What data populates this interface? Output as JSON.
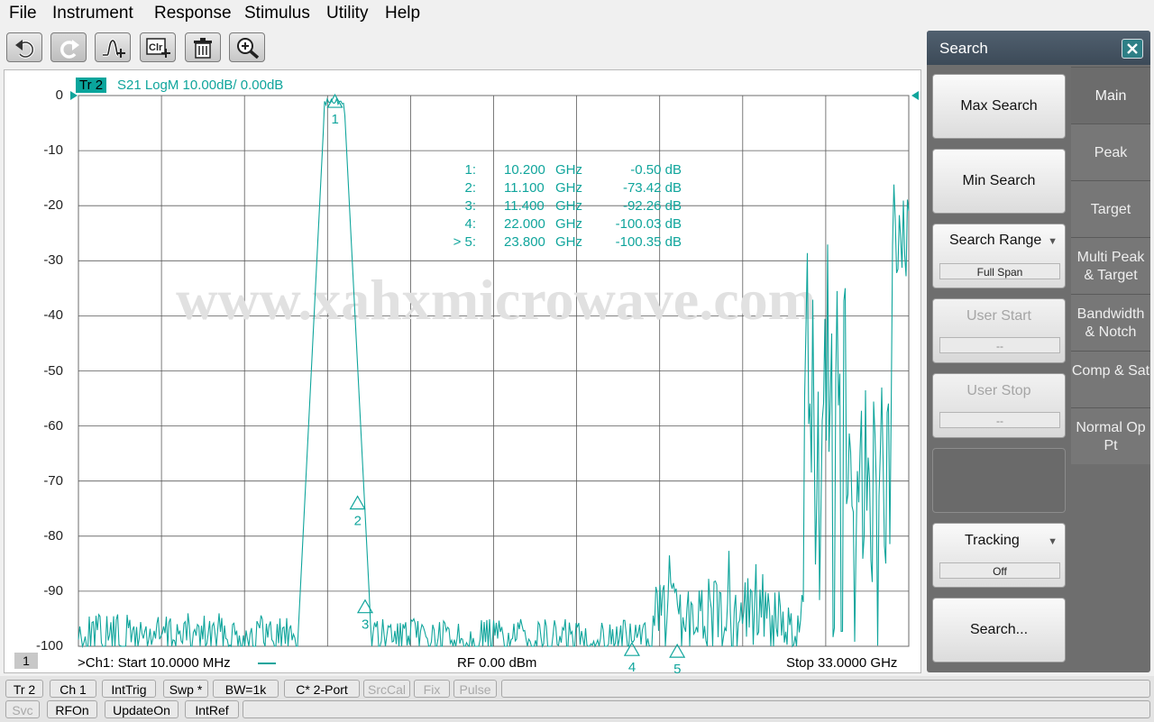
{
  "menu": [
    "File",
    "Instrument",
    "Response",
    "Stimulus",
    "Utility",
    "Help"
  ],
  "toolbar": [
    "undo-icon",
    "redo-icon",
    "add-marker-icon",
    "clear-icon",
    "delete-icon",
    "zoom-icon"
  ],
  "plot": {
    "trace_tab": "Tr 2",
    "trace_title": "S21 LogM 10.00dB/  0.00dB",
    "y_ticks": [
      "0",
      "-10",
      "-20",
      "-30",
      "-40",
      "-50",
      "-60",
      "-70",
      "-80",
      "-90",
      "-100"
    ],
    "watermark": "www.xahxmicrowave.com",
    "markers": [
      {
        "id": "1:",
        "freq": "10.200",
        "unit": "GHz",
        "val": "-0.50 dB"
      },
      {
        "id": "2:",
        "freq": "11.100",
        "unit": "GHz",
        "val": "-73.42 dB"
      },
      {
        "id": "3:",
        "freq": "11.400",
        "unit": "GHz",
        "val": "-92.26 dB"
      },
      {
        "id": "4:",
        "freq": "22.000",
        "unit": "GHz",
        "val": "-100.03 dB"
      },
      {
        "id": "> 5:",
        "freq": "23.800",
        "unit": "GHz",
        "val": "-100.35 dB"
      }
    ],
    "marker_labels": [
      "1",
      "2",
      "3",
      "4",
      "5"
    ],
    "channel_num": "1",
    "start_label": ">Ch1:  Start   10.0000 MHz",
    "rf_label": "RF    0.00 dBm",
    "stop_label": "Stop  33.0000 GHz",
    "trace_color": "#10a59c"
  },
  "status": {
    "row1": [
      "Tr 2",
      "Ch 1",
      "IntTrig",
      "Swp *",
      "BW=1k",
      "C* 2-Port",
      "SrcCal",
      "Fix",
      "Pulse"
    ],
    "row2": [
      "Svc",
      "RFOn",
      "UpdateOn",
      "IntRef"
    ]
  },
  "panel": {
    "title": "Search",
    "buttons": {
      "max": "Max Search",
      "min": "Min Search",
      "range": "Search Range",
      "range_value": "Full Span",
      "user_start": "User Start",
      "user_start_value": "--",
      "user_stop": "User Stop",
      "user_stop_value": "--",
      "tracking": "Tracking",
      "tracking_value": "Off",
      "search": "Search..."
    },
    "tabs": [
      "Main",
      "Peak",
      "Target",
      "Multi Peak & Target",
      "Bandwidth & Notch",
      "Comp & Sat",
      "Normal Op Pt"
    ]
  }
}
